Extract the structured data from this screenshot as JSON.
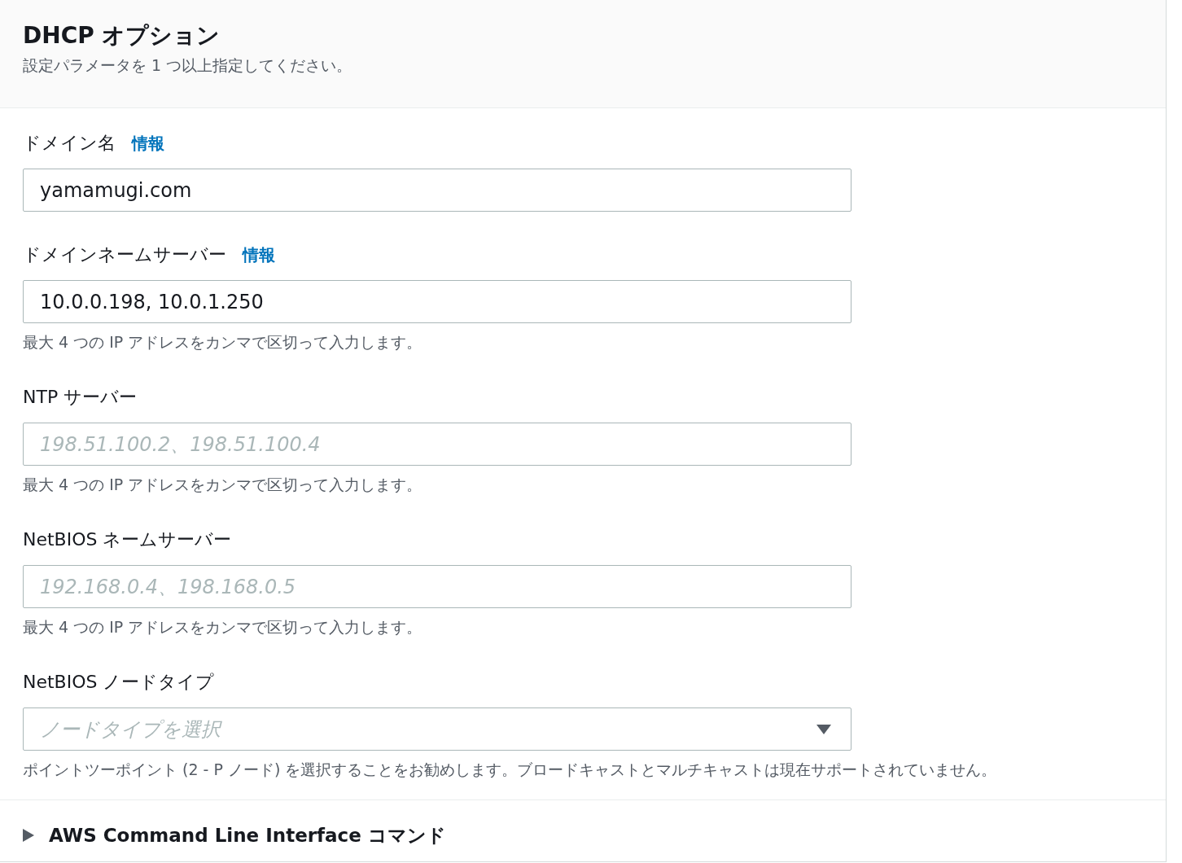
{
  "header": {
    "title": "DHCP オプション",
    "description": "設定パラメータを 1 つ以上指定してください。"
  },
  "fields": [
    {
      "kind": "text",
      "label": "ドメイン名",
      "info": "情報",
      "value": "yamamugi.com"
    },
    {
      "kind": "text",
      "label": "ドメインネームサーバー",
      "info": "情報",
      "value": "10.0.0.198, 10.0.1.250",
      "hint": "最大 4 つの IP アドレスをカンマで区切って入力します。"
    },
    {
      "kind": "text",
      "label": "NTP サーバー",
      "placeholder": "198.51.100.2、198.51.100.4",
      "hint": "最大 4 つの IP アドレスをカンマで区切って入力します。"
    },
    {
      "kind": "text",
      "label": "NetBIOS ネームサーバー",
      "placeholder": "192.168.0.4、198.168.0.5",
      "hint": "最大 4 つの IP アドレスをカンマで区切って入力します。"
    },
    {
      "kind": "select",
      "label": "NetBIOS ノードタイプ",
      "placeholder": "ノードタイプを選択",
      "hint": "ポイントツーポイント (2 - P ノード) を選択することをお勧めします。ブロードキャストとマルチキャストは現在サポートされていません。"
    }
  ],
  "cli": {
    "label": "AWS Command Line Interface コマンド",
    "expanded": false
  }
}
